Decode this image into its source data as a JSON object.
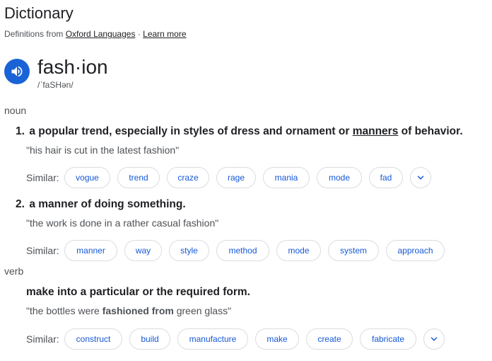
{
  "header": {
    "title": "Dictionary",
    "source_prefix": "Definitions from",
    "source_link": "Oxford Languages",
    "separator": "·",
    "learn_more": "Learn more"
  },
  "entry": {
    "word": "fash·ion",
    "phonetic": "/ˈfaSHən/"
  },
  "noun": {
    "label": "noun",
    "senses": [
      {
        "num": "1.",
        "def_before": "a popular trend, especially in styles of dress and ornament or ",
        "def_link": "manners",
        "def_after": " of behavior.",
        "example": "\"his hair is cut in the latest fashion\"",
        "similar_label": "Similar:",
        "similar": [
          "vogue",
          "trend",
          "craze",
          "rage",
          "mania",
          "mode",
          "fad"
        ]
      },
      {
        "num": "2.",
        "def": "a manner of doing something.",
        "example": "\"the work is done in a rather casual fashion\"",
        "similar_label": "Similar:",
        "similar": [
          "manner",
          "way",
          "style",
          "method",
          "mode",
          "system",
          "approach"
        ]
      }
    ]
  },
  "verb": {
    "label": "verb",
    "def": "make into a particular or the required form.",
    "example_before": "\"the bottles were ",
    "example_bold": "fashioned from",
    "example_after": " green glass\"",
    "similar_label": "Similar:",
    "similar": [
      "construct",
      "build",
      "manufacture",
      "make",
      "create",
      "fabricate"
    ]
  },
  "icons": {
    "speaker": "speaker-icon",
    "expand": "chevron-down-icon"
  },
  "colors": {
    "speaker_bg": "#1a63d6",
    "chip_text": "#1558d6",
    "chip_border": "#dadce0"
  }
}
